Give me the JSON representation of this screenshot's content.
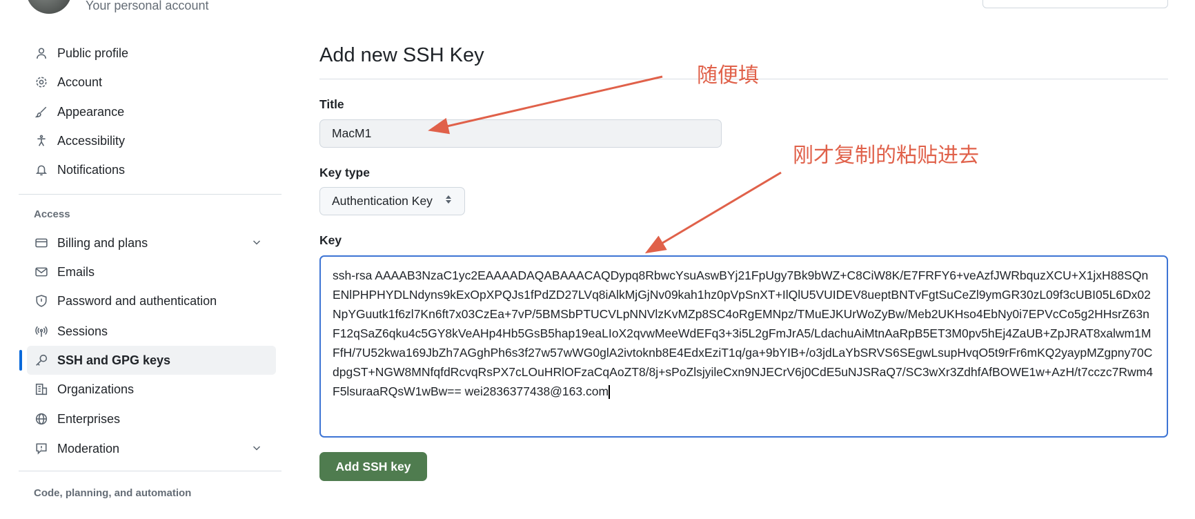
{
  "header": {
    "subtitle": "Your personal account"
  },
  "sidebar": {
    "items": [
      {
        "label": "Public profile",
        "icon": "person-icon"
      },
      {
        "label": "Account",
        "icon": "gear-icon"
      },
      {
        "label": "Appearance",
        "icon": "paintbrush-icon"
      },
      {
        "label": "Accessibility",
        "icon": "accessibility-icon"
      },
      {
        "label": "Notifications",
        "icon": "bell-icon"
      }
    ],
    "access_heading": "Access",
    "access_items": [
      {
        "label": "Billing and plans",
        "icon": "credit-card-icon"
      },
      {
        "label": "Emails",
        "icon": "mail-icon"
      },
      {
        "label": "Password and authentication",
        "icon": "shield-icon"
      },
      {
        "label": "Sessions",
        "icon": "broadcast-icon"
      },
      {
        "label": "SSH and GPG keys",
        "icon": "key-icon",
        "active": true
      },
      {
        "label": "Organizations",
        "icon": "organization-icon"
      },
      {
        "label": "Enterprises",
        "icon": "globe-icon"
      },
      {
        "label": "Moderation",
        "icon": "report-icon"
      }
    ],
    "code_heading": "Code, planning, and automation"
  },
  "main": {
    "title": "Add new SSH Key",
    "title_label": "Title",
    "title_value": "MacM1",
    "key_type_label": "Key type",
    "key_type_value": "Authentication Key",
    "key_label": "Key",
    "key_value": "ssh-rsa AAAAB3NzaC1yc2EAAAADAQABAAACAQDypq8RbwcYsuAswBYj21FpUgy7Bk9bWZ+C8CiW8K/E7FRFY6+veAzfJWRbquzXCU+X1jxH88SQnENlPHPHYDLNdyns9kExOpXPQJs1fPdZD27LVq8iAlkMjGjNv09kah1hz0pVpSnXT+IlQlU5VUIDEV8ueptBNTvFgtSuCeZl9ymGR30zL09f3cUBI05L6Dx02NpYGuutk1f6zl7Kn6ft7x03CzEa+7vP/5BMSbPTUCVLpNNVlzKvMZp8SC4oRgEMNpz/TMuEJKUrWoZyBw/Meb2UKHso4EbNy0i7EPVcCo5g2HHsrZ63nF12qSaZ6qku4c5GY8kVeAHp4Hb5GsB5hap19eaLIoX2qvwMeeWdEFq3+3i5L2gFmJrA5/LdachuAiMtnAaRpB5ET3M0pv5hEj4ZaUB+ZpJRAT8xalwm1MFfH/7U52kwa169JbZh7AGghPh6s3f27w57wWG0glA2ivtoknb8E4EdxEziT1q/ga+9bYIB+/o3jdLaYbSRVS6SEgwLsupHvqO5t9rFr6mKQ2yaypMZgpny70CdpgST+NGW8MNfqfdRcvqRsPX7cLOuHRlOFzaCqAoZT8/8j+sPoZlsjyileCxn9NJECrV6j0CdE5uNJSRaQ7/SC3wXr3ZdhfAfBOWE1w+AzH/t7cczc7Rwm4F5lsuraaRQsW1wBw== wei2836377438@163.com",
    "submit_label": "Add SSH key"
  },
  "annotations": {
    "title_note": "随便填",
    "key_note": "刚才复制的粘贴进去",
    "color": "#e0614a"
  }
}
